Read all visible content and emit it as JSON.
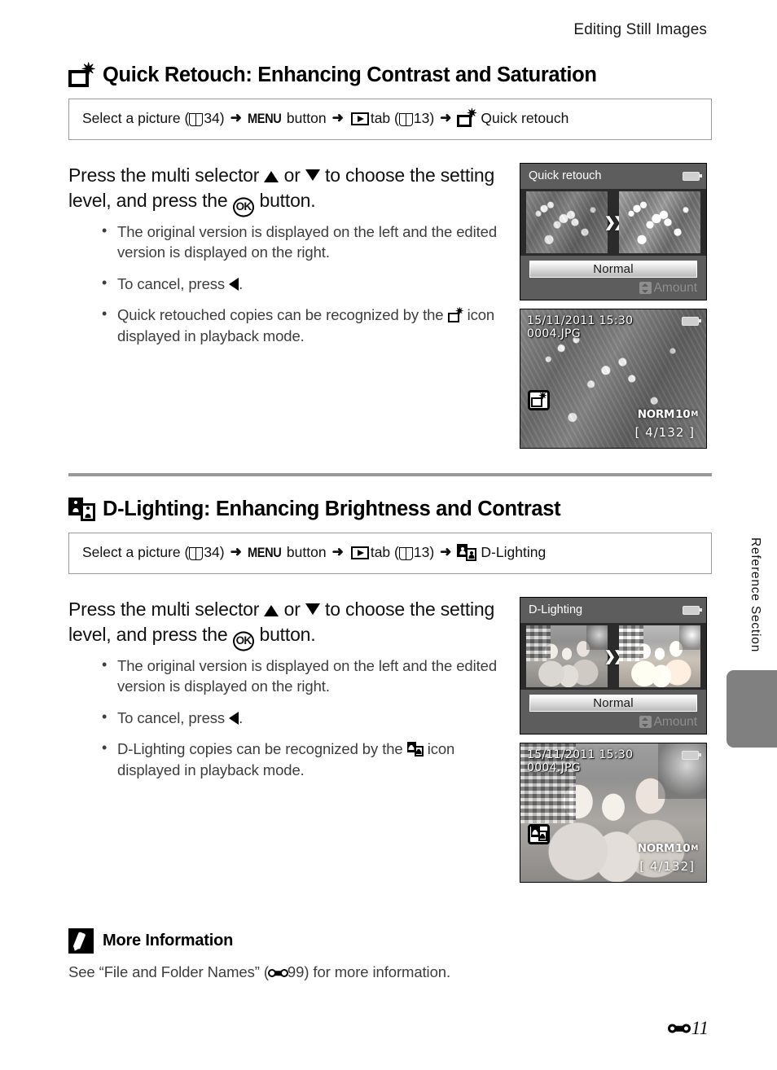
{
  "page": {
    "header_title": "Editing Still Images",
    "footer_page": "11",
    "side_tab_label": "Reference Section"
  },
  "sections": [
    {
      "id": "quick-retouch",
      "icon": "quick-retouch-icon",
      "title": "Quick Retouch: Enhancing Contrast and Saturation",
      "path": {
        "select": "Select a picture (",
        "select_page": "34",
        "select_close": ")",
        "menu_label": "MENU",
        "menu_suffix": " button",
        "tab_label": " tab (",
        "tab_page": "13",
        "tab_close": ")",
        "final_label": "Quick retouch"
      },
      "lead_part1": "Press the multi selector ",
      "lead_or": " or ",
      "lead_part2": " to choose the setting level, and press the ",
      "lead_part3": " button.",
      "bullets": [
        "The original version is displayed on the left and the edited version is displayed on the right.",
        "To cancel, press ",
        "Quick retouched copies can be recognized by the "
      ],
      "bullet2_suffix": ".",
      "bullet3_suffix": " icon displayed in playback mode.",
      "screen_menu": {
        "title": "Quick retouch",
        "level_label": "Normal",
        "amount_label": "Amount"
      },
      "screen_play": {
        "date": "15/11/2011  15:30",
        "filename": "0004.JPG",
        "quality": "NORM",
        "size": "10",
        "size_unit": "M",
        "counter": "[  4/132 ]"
      }
    },
    {
      "id": "d-lighting",
      "icon": "d-lighting-icon",
      "title": "D-Lighting: Enhancing Brightness and Contrast",
      "path": {
        "select": "Select a picture (",
        "select_page": "34",
        "select_close": ")",
        "menu_label": "MENU",
        "menu_suffix": " button",
        "tab_label": " tab (",
        "tab_page": "13",
        "tab_close": ")",
        "final_label": "D-Lighting"
      },
      "lead_part1": "Press the multi selector ",
      "lead_or": " or ",
      "lead_part2": " to choose the setting level, and press the ",
      "lead_part3": " button.",
      "bullets": [
        "The original version is displayed on the left and the edited version is displayed on the right.",
        "To cancel, press ",
        "D-Lighting copies can be recognized by the "
      ],
      "bullet2_suffix": ".",
      "bullet3_suffix": " icon displayed in playback mode.",
      "screen_menu": {
        "title": "D-Lighting",
        "level_label": "Normal",
        "amount_label": "Amount"
      },
      "screen_play": {
        "date": "15/11/2011  15:30",
        "filename": "0004.JPG",
        "quality": "NORM",
        "size": "10",
        "size_unit": "M",
        "counter": "[  4/132]"
      }
    }
  ],
  "more_information": {
    "title": "More Information",
    "text_before": "See “File and Folder Names” (",
    "ref_page": "99",
    "text_after": ") for more information."
  },
  "ok_button_glyph": "OK"
}
